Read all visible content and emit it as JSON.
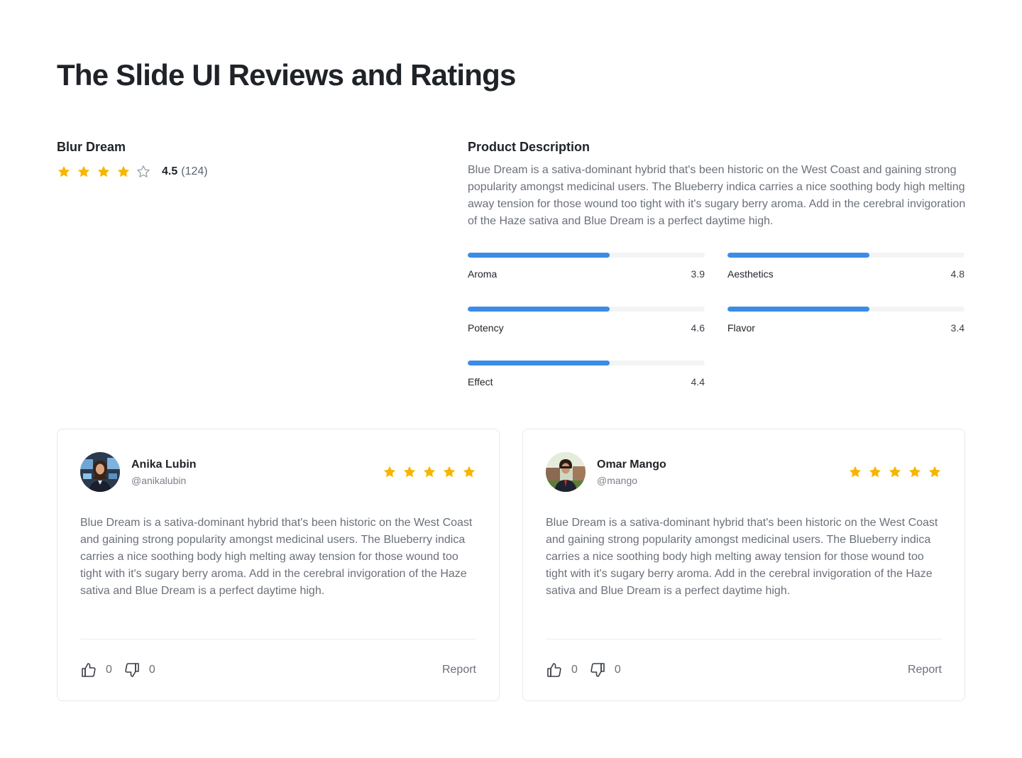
{
  "page": {
    "title": "The Slide UI Reviews and Ratings"
  },
  "colors": {
    "star": "#f7b500",
    "star_empty": "#9aa0a6",
    "bar": "#3b8ce6",
    "track": "#f3f4f6"
  },
  "product": {
    "name": "Blur Dream",
    "rating": "4.5",
    "review_count": "(124)",
    "stars_filled": 4,
    "stars_total": 5
  },
  "description": {
    "title": "Product Description",
    "text": "Blue Dream is a sativa-dominant hybrid that's been historic on the West Coast and gaining strong popularity amongst medicinal users. The Blueberry indica carries a nice soothing body high melting away tension for those wound too tight with it's sugary berry aroma. Add in the cerebral invigoration of the Haze sativa and Blue Dream is a perfect daytime high."
  },
  "metrics": [
    {
      "label": "Aroma",
      "value": "3.9",
      "fill": 0.6
    },
    {
      "label": "Aesthetics",
      "value": "4.8",
      "fill": 0.6
    },
    {
      "label": "Potency",
      "value": "4.6",
      "fill": 0.6
    },
    {
      "label": "Flavor",
      "value": "3.4",
      "fill": 0.6
    },
    {
      "label": "Effect",
      "value": "4.4",
      "fill": 0.6
    }
  ],
  "reviews": [
    {
      "name": "Anika Lubin",
      "handle": "@anikalubin",
      "stars": 5,
      "avatar_icon": "avatar-woman-office",
      "text": "Blue Dream is a sativa-dominant hybrid that's been historic on the West Coast and gaining strong popularity amongst medicinal users. The Blueberry indica carries a nice soothing body high melting away tension for those wound too tight with it's sugary berry aroma. Add in the cerebral invigoration of the Haze sativa and Blue Dream is a perfect daytime high.",
      "likes": "0",
      "dislikes": "0",
      "report_label": "Report"
    },
    {
      "name": "Omar Mango",
      "handle": "@mango",
      "stars": 5,
      "avatar_icon": "avatar-man-suit",
      "text": "Blue Dream is a sativa-dominant hybrid that's been historic on the West Coast and gaining strong popularity amongst medicinal users. The Blueberry indica carries a nice soothing body high melting away tension for those wound too tight with it's sugary berry aroma. Add in the cerebral invigoration of the Haze sativa and Blue Dream is a perfect daytime high.",
      "likes": "0",
      "dislikes": "0",
      "report_label": "Report"
    }
  ]
}
